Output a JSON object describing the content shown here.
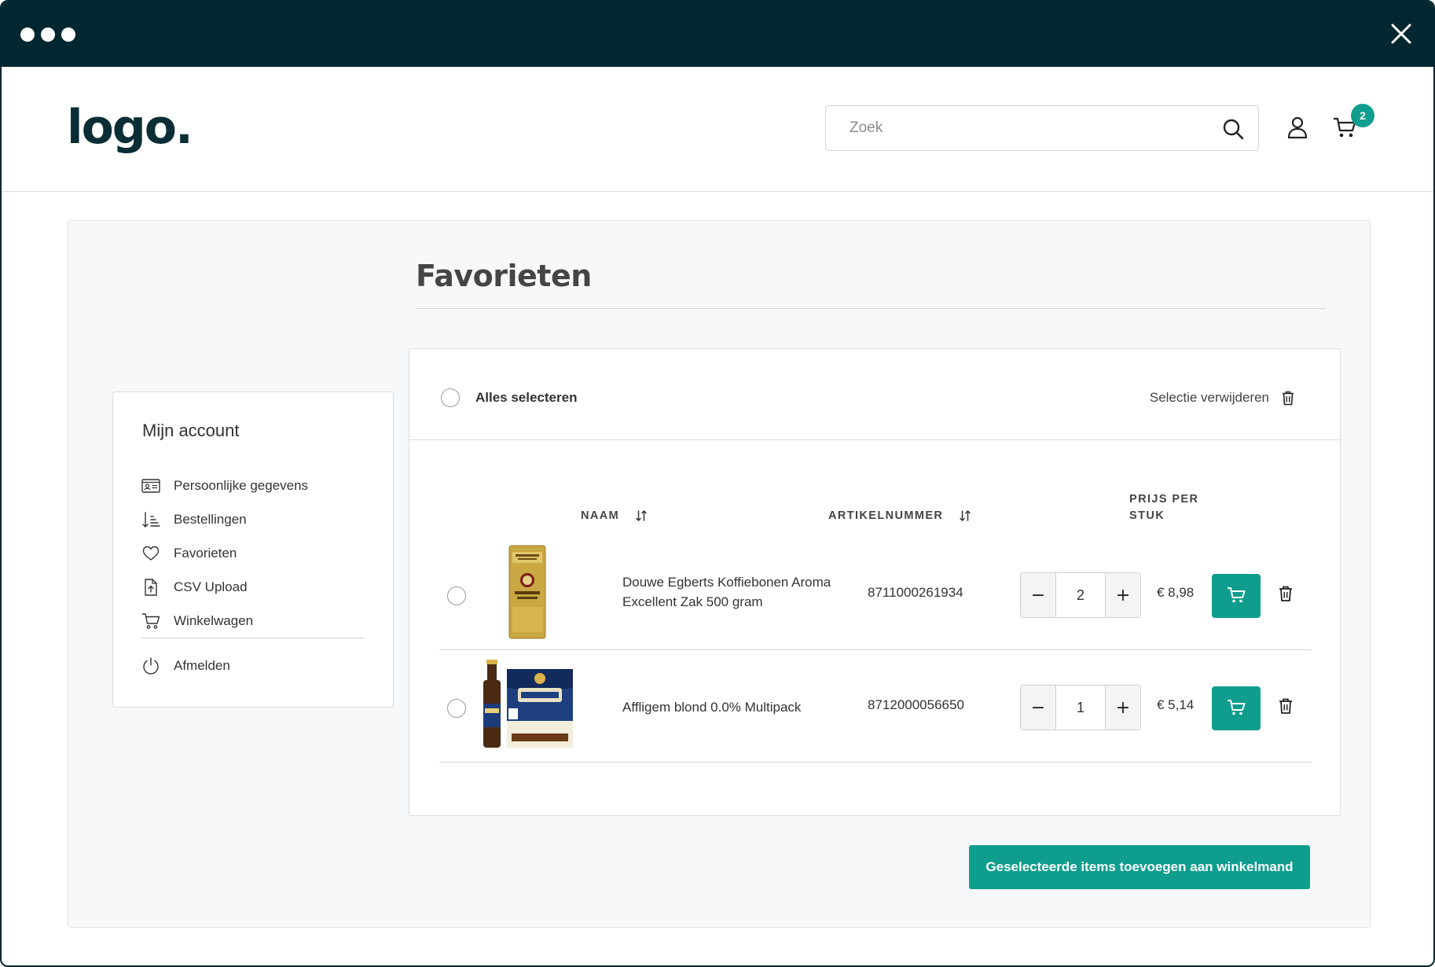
{
  "window": {
    "close_icon": "close-icon"
  },
  "header": {
    "logo": "logo.",
    "search_placeholder": "Zoek",
    "cart_count": "2"
  },
  "sidebar": {
    "title": "Mijn account",
    "items": [
      {
        "label": "Persoonlijke gegevens",
        "icon": "id-card-icon"
      },
      {
        "label": "Bestellingen",
        "icon": "sort-list-icon"
      },
      {
        "label": "Favorieten",
        "icon": "heart-icon"
      },
      {
        "label": "CSV Upload",
        "icon": "file-upload-icon"
      },
      {
        "label": "Winkelwagen",
        "icon": "cart-icon"
      }
    ],
    "logout_label": "Afmelden"
  },
  "page": {
    "title": "Favorieten"
  },
  "favorites": {
    "select_all_label": "Alles selecteren",
    "remove_selection_label": "Selectie verwijderen",
    "columns": {
      "name": "NAAM",
      "sku": "ARTIKELNUMMER",
      "price_line1": "PRIJS PER",
      "price_line2": "STUK"
    },
    "rows": [
      {
        "name_line1": "Douwe Egberts Koffiebonen Aroma",
        "name_line2": "Excellent Zak 500 gram",
        "sku": "8711000261934",
        "quantity": "2",
        "price": "€ 8,98"
      },
      {
        "name_line1": "Affligem blond 0.0% Multipack",
        "name_line2": "",
        "sku": "8712000056650",
        "quantity": "1",
        "price": "€ 5,14"
      }
    ],
    "stepper_minus": "−",
    "stepper_plus": "+",
    "add_selected_label": "Geselecteerde items toevoegen aan winkelmand"
  },
  "colors": {
    "accent": "#0f9e8e",
    "titlebar": "#032730",
    "panel": "#f7f8f9"
  }
}
